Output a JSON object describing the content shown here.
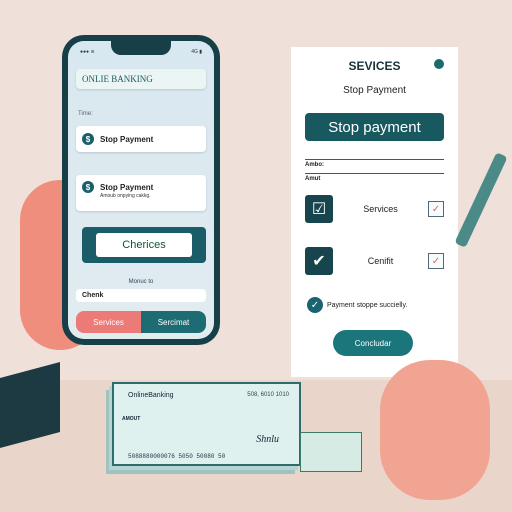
{
  "phone": {
    "header": "ONLIE BANKING",
    "time_label": "Time:",
    "items": [
      {
        "label": "Stop Payment",
        "sub": ""
      },
      {
        "label": "Stop Payment",
        "sub": "Amoub onpying cakkg."
      }
    ],
    "choices_button": "Cherices",
    "caption": "Monuc to",
    "input_value": "Chenk",
    "segments": [
      "Services",
      "Sercimat"
    ]
  },
  "panel": {
    "title": "SEVICES",
    "subtitle": "Stop Payment",
    "primary_button": "Stop payment",
    "fields": [
      "Ambo:",
      "Amut"
    ],
    "options": [
      {
        "label": "Services",
        "checked": true
      },
      {
        "label": "Cenifit",
        "checked": true
      }
    ],
    "success": "Payment stoppe succielly.",
    "confirm_button": "Concludar"
  },
  "check": {
    "bank": "OnlineBanking",
    "number": "508, 6010   1010",
    "amount_label": "AMOUT",
    "signature": "Shnlu",
    "micr": "5088880000076  5050  50080  50"
  }
}
